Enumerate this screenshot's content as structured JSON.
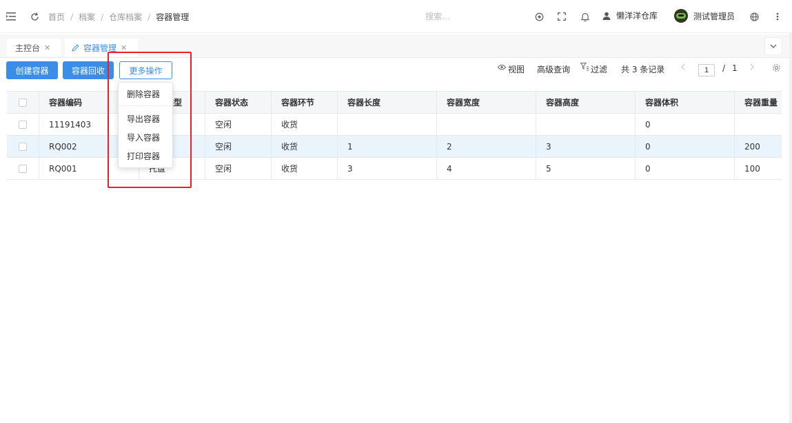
{
  "header": {
    "breadcrumb": [
      "首页",
      "档案",
      "仓库档案",
      "容器管理"
    ],
    "separator": "/",
    "search_placeholder": "搜索...",
    "warehouse": "懒洋洋仓库",
    "user": "测试管理员"
  },
  "tabs": [
    {
      "label": "主控台",
      "close": "✕"
    },
    {
      "label": "容器管理",
      "close": "✕"
    }
  ],
  "toolbar": {
    "create": "创建容器",
    "recycle": "容器回收",
    "more": "更多操作",
    "view": "视图",
    "advanced_query": "高级查询",
    "filter": "过滤",
    "total": "共 3 条记录",
    "page_current": "1",
    "page_sep": "/",
    "page_total": "1"
  },
  "dropdown": {
    "items": [
      "删除容器",
      "导出容器",
      "导入容器",
      "打印容器"
    ]
  },
  "table": {
    "columns": [
      "容器编码",
      "容器类型",
      "容器状态",
      "容器环节",
      "容器长度",
      "容器宽度",
      "容器高度",
      "容器体积",
      "容器重量"
    ],
    "rows": [
      [
        "11191403",
        "",
        "空闲",
        "收货",
        "",
        "",
        "",
        "0",
        ""
      ],
      [
        "RQ002",
        "",
        "空闲",
        "收货",
        "1",
        "2",
        "3",
        "0",
        "200"
      ],
      [
        "RQ001",
        "托盘",
        "空闲",
        "收货",
        "3",
        "4",
        "5",
        "0",
        "100"
      ]
    ]
  },
  "colors": {
    "primary": "#3a8ee6",
    "highlight": "#e8202a",
    "row_highlight": "#eaf4fd"
  }
}
